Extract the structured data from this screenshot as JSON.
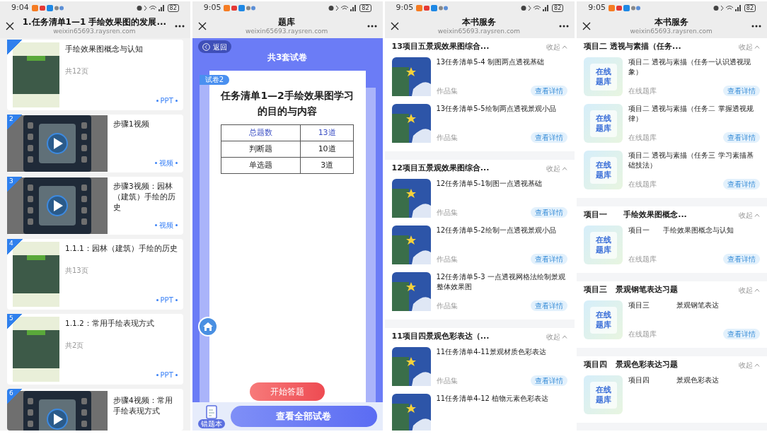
{
  "panels": [
    {
      "kind": "resources",
      "status": {
        "time": "9:04",
        "battery": "82"
      },
      "header": {
        "title": "1.任务清单1—1 手绘效果图的发展...",
        "url": "weixin65693.raysren.com"
      },
      "items": [
        {
          "kind": "ppt",
          "title": "手绘效果图概念与认知",
          "pages": "共12页",
          "tag": "PPT"
        },
        {
          "kind": "video",
          "number": "2",
          "title": "步骤1视频",
          "tag": "视频"
        },
        {
          "kind": "video",
          "number": "3",
          "title": "步骤3视频：园林（建筑）手绘的历史",
          "tag": "视频"
        },
        {
          "kind": "ppt",
          "number": "4",
          "title": "1.1.1：园林（建筑）手绘的历史",
          "pages": "共13页",
          "tag": "PPT"
        },
        {
          "kind": "ppt",
          "number": "5",
          "title": "1.1.2：常用手绘表现方式",
          "pages": "共2页",
          "tag": "PPT"
        },
        {
          "kind": "video",
          "number": "6",
          "title": "步骤4视频：常用手绘表现方式"
        }
      ]
    },
    {
      "kind": "quiz",
      "status": {
        "time": "9:05",
        "battery": "82"
      },
      "header": {
        "title": "题库",
        "url": "weixin65693.raysren.com"
      },
      "back": "返回",
      "heading": "共3套试卷",
      "card": {
        "tag": "试卷2",
        "title": "任务清单1—2手绘效果图学习的目的与内容",
        "rows": [
          {
            "label": "总题数",
            "value": "13道",
            "highlight": true
          },
          {
            "label": "判断题",
            "value": "10道",
            "highlight": false
          },
          {
            "label": "单选题",
            "value": "3道",
            "highlight": false
          }
        ]
      },
      "start": "开始答题",
      "notebook": "错题本",
      "view_all": "查看全部试卷"
    },
    {
      "kind": "services",
      "status": {
        "time": "9:05",
        "battery": "82"
      },
      "header": {
        "title": "本书服务",
        "url": "weixin65693.raysren.com"
      },
      "sections": [
        {
          "title": "13项目五景观效果图综合...",
          "collapse": "收起",
          "items": [
            {
              "kind": "illustration",
              "title": "13任务清单5-4 制图两点透视基础",
              "type": "作品集",
              "action": "查看详情"
            },
            {
              "kind": "illustration",
              "title": "13任务清单5-5绘制两点透视景观小品",
              "type": "作品集",
              "action": "查看详情"
            }
          ]
        },
        {
          "title": "12项目五景观效果图综合...",
          "collapse": "收起",
          "items": [
            {
              "kind": "illustration",
              "title": "12任务清单5-1制图一点透视基础",
              "type": "作品集",
              "action": "查看详情"
            },
            {
              "kind": "illustration",
              "title": "12任务清单5-2绘制一点透视景观小品",
              "type": "作品集",
              "action": "查看详情"
            },
            {
              "kind": "illustration",
              "title": "12任务清单5-3 一点透视网格法绘制景观整体效果图",
              "type": "作品集",
              "action": "查看详情"
            }
          ]
        },
        {
          "title": "11项目四景观色彩表达（...",
          "collapse": "收起",
          "items": [
            {
              "kind": "illustration",
              "title": "11任务清单4-11景观材质色彩表达",
              "type": "作品集",
              "action": "查看详情"
            },
            {
              "kind": "illustration",
              "title": "11任务清单4-12 植物元素色彩表达"
            }
          ]
        }
      ]
    },
    {
      "kind": "services",
      "status": {
        "time": "9:05",
        "battery": "82"
      },
      "header": {
        "title": "本书服务",
        "url": "weixin65693.raysren.com"
      },
      "sections": [
        {
          "title": "项目二 透视与素描（任务...",
          "collapse": "收起",
          "items": [
            {
              "kind": "quiz",
              "thumb_label": "在线题库",
              "title": "项目二 透视与素描（任务一认识透视现象）",
              "type": "在线题库",
              "action": "查看详情"
            },
            {
              "kind": "quiz",
              "thumb_label": "在线题库",
              "title": "项目二 透视与素描（任务二 掌握透视规律）",
              "type": "在线题库",
              "action": "查看详情"
            },
            {
              "kind": "quiz",
              "thumb_label": "在线题库",
              "title": "项目二 透视与素描（任务三 学习素描基础技法）",
              "type": "在线题库",
              "action": "查看详情"
            }
          ]
        },
        {
          "title": "项目一      手绘效果图概念...",
          "collapse": "收起",
          "items": [
            {
              "kind": "quiz",
              "thumb_label": "在线题库",
              "title": "项目一      手绘效果图概念与认知",
              "type": "在线题库",
              "action": "查看详情"
            }
          ]
        },
        {
          "title": "项目三   景观钢笔表达习题",
          "collapse": "收起",
          "items": [
            {
              "kind": "quiz",
              "thumb_label": "在线题库",
              "title": "项目三            景观钢笔表达",
              "type": "在线题库",
              "action": "查看详情"
            }
          ]
        },
        {
          "title": "项目四   景观色彩表达习题",
          "collapse": "收起",
          "items": [
            {
              "kind": "quiz",
              "thumb_label": "在线题库",
              "title": "项目四            景观色彩表达"
            }
          ]
        }
      ]
    }
  ]
}
